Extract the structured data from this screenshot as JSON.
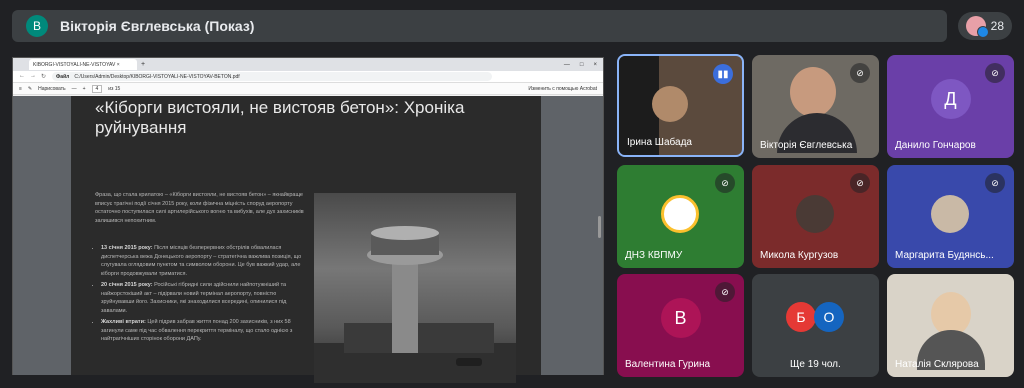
{
  "topbar": {
    "avatar_letter": "В",
    "title": "Вікторія Євглевська (Показ)",
    "people_count": "28"
  },
  "browser": {
    "tab_label": "KIBORGI-VISTOYALI-NE-VISTOYAV",
    "tab_close": "×",
    "new_tab": "+",
    "window_controls": [
      "—",
      "□",
      "×"
    ],
    "url_prefix": "Файл",
    "url": "C:/Users/Admin/Desktop/KIBORGI-VISTOYALI-NE-VISTOYAV-BETON.pdf",
    "pdf_toolbar": {
      "draw_label": "Нарисовать",
      "page_current": "4",
      "page_total": "из 15",
      "zoom_minus": "—",
      "zoom_plus": "+",
      "save_label": "Изменить с помощью Acrobat"
    }
  },
  "document": {
    "title": "«Кіборги вистояли, не вистояв бетон»: Хроніка руйнування",
    "lede": "Фраза, що стала крилатою – «Кіборги вистояли, не вистояв бетон» – якнайкраще вписує трагічні події січня 2015 року, коли фізична міцність споруд аеропорту остаточно поступилася силі артилерійського вогню та вибухів, але дух захисників залишився непохитним.",
    "bullets": [
      {
        "head": "13 січня 2015 року:",
        "text": " Після місяців безперервних обстрілів обвалилася диспетчерська вежа Донецького аеропорту – стратегічна важлива позиція, що слугувала оглядовим пунктом та символом оборони. Це був важкий удар, але кіборги продовжували триматися."
      },
      {
        "head": "20 січня 2015 року:",
        "text": " Російські гібридні сили здійснили найпотужніший та найжорстокіший акт – підірвали новий термінал аеропорту, повністю зруйнувавши його. Захисники, які знаходилися всередині, опинилися під завалами."
      },
      {
        "head": "Жахливі втрати:",
        "text": " Цей підрив забрав життя понад 200 захисників, з них 58 загинули саме під час обвалення перекриття терміналу, що стало однією з найтрагічніших сторінок оборони ДАПу."
      }
    ]
  },
  "participants": [
    {
      "name": "Ірина Шабада",
      "state": "speaking"
    },
    {
      "name": "Вікторія Євглевська",
      "state": "muted"
    },
    {
      "name": "Данило Гончаров",
      "state": "muted",
      "avatar": "Д"
    },
    {
      "name": "ДНЗ КВПМУ",
      "state": "muted"
    },
    {
      "name": "Микола Кургузов",
      "state": "muted"
    },
    {
      "name": "Маргарита Будянсь...",
      "state": "muted"
    },
    {
      "name": "Валентина Гурина",
      "state": "muted",
      "avatar": "В"
    },
    {
      "name": "Ще 19 чол.",
      "avatars": [
        "Б",
        "О"
      ]
    },
    {
      "name": "Наталія Склярова",
      "state": "video"
    }
  ],
  "colors": {
    "background": "#202124",
    "tile_purple": "#6a3fa8",
    "tile_blue": "#3949ab",
    "tile_green": "#2e7d32",
    "tile_maroon": "#7b2b2b",
    "tile_pink": "#880e4f",
    "active_border": "#8ab4f8"
  }
}
